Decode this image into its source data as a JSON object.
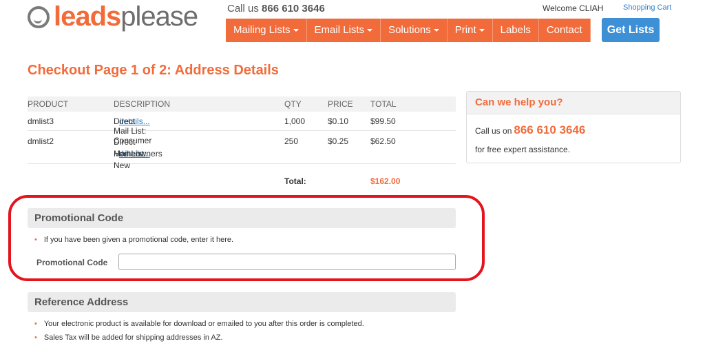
{
  "header": {
    "logo_leads": "leads",
    "logo_please": "please",
    "call_prefix": "Call us ",
    "phone": "866 610 3646",
    "welcome": "Welcome CLIAH",
    "cart_link": "Shopping Cart",
    "nav": [
      {
        "label": "Mailing Lists",
        "dropdown": true
      },
      {
        "label": "Email Lists",
        "dropdown": true
      },
      {
        "label": "Solutions",
        "dropdown": true
      },
      {
        "label": "Print",
        "dropdown": true
      },
      {
        "label": "Labels",
        "dropdown": false
      },
      {
        "label": "Contact",
        "dropdown": false
      }
    ],
    "cta": "Get Lists"
  },
  "page": {
    "title": "Checkout Page 1 of 2: Address Details"
  },
  "cart": {
    "columns": [
      "PRODUCT",
      "DESCRIPTION",
      "QTY",
      "PRICE",
      "TOTAL"
    ],
    "rows": [
      {
        "product": "dmlist3",
        "description": "Direct Mail List: Consumer",
        "desc_line2": "",
        "link": "details...",
        "qty": "1,000",
        "price": "$0.10",
        "total": "$99.50"
      },
      {
        "product": "dmlist2",
        "description": "Direct Mail List: New",
        "desc_line2": "Homeowners",
        "link": "details...",
        "qty": "250",
        "price": "$0.25",
        "total": "$62.50"
      }
    ],
    "total_label": "Total:",
    "total_value": "$162.00"
  },
  "help": {
    "heading": "Can we help you?",
    "line1_prefix": "Call us on",
    "phone": "866 610 3646",
    "line2": "for free expert assistance."
  },
  "promo": {
    "heading": "Promotional Code",
    "bullet": "If you have been given a promotional code, enter it here.",
    "label": "Promotional Code",
    "value": "",
    "placeholder": ""
  },
  "reference": {
    "heading": "Reference Address",
    "bullets": [
      "Your electronic product is available for download or emailed to you after this order is completed.",
      "Sales Tax will be added for shipping addresses in AZ."
    ]
  },
  "colors": {
    "brand_orange": "#f26b3a",
    "cta_blue": "#3d8fd6",
    "highlight_red": "#e5131b"
  }
}
